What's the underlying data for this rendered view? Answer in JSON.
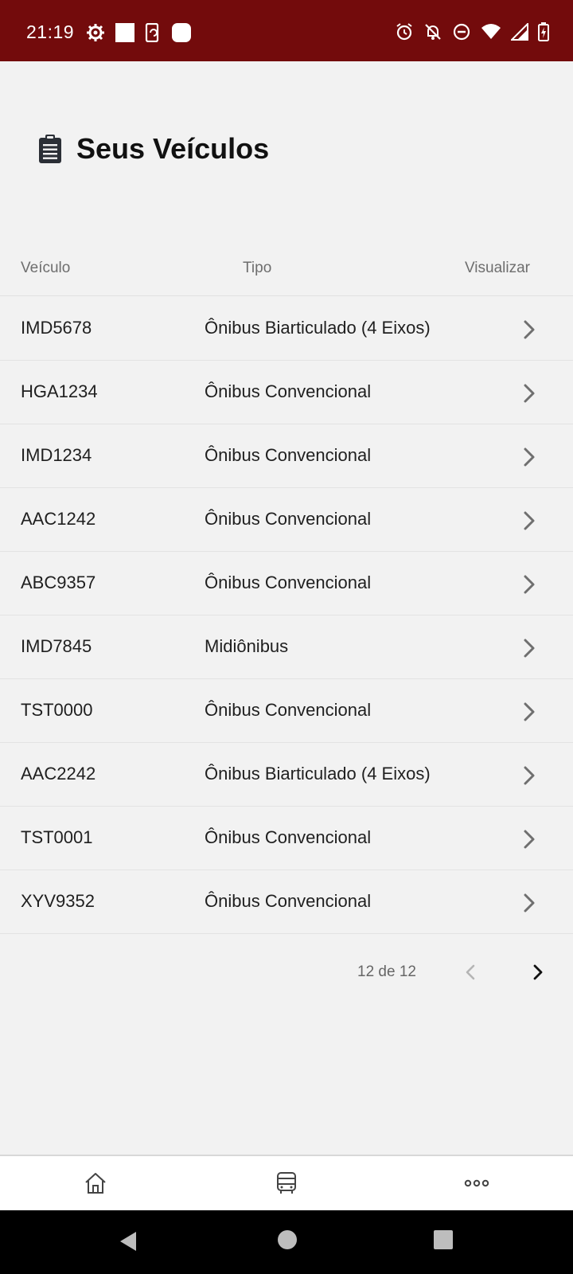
{
  "status_bar": {
    "time": "21:19",
    "left_icons": [
      "settings-gear-icon",
      "white-square-icon",
      "phone-sync-icon",
      "rounded-square-icon"
    ],
    "right_icons": [
      "alarm-icon",
      "notifications-off-icon",
      "do-not-disturb-icon",
      "wifi-icon",
      "signal-icon",
      "battery-charging-icon"
    ],
    "background": "#730b0c"
  },
  "header": {
    "icon": "clipboard-list-icon",
    "title": "Seus Veículos"
  },
  "table": {
    "columns": [
      "Veículo",
      "Tipo",
      "Visualizar"
    ],
    "rows": [
      {
        "plate": "IMD5678",
        "type": "Ônibus Biarticulado (4 Eixos)"
      },
      {
        "plate": "HGA1234",
        "type": "Ônibus Convencional"
      },
      {
        "plate": "IMD1234",
        "type": "Ônibus Convencional"
      },
      {
        "plate": "AAC1242",
        "type": "Ônibus Convencional"
      },
      {
        "plate": "ABC9357",
        "type": "Ônibus Convencional"
      },
      {
        "plate": "IMD7845",
        "type": "Midiônibus"
      },
      {
        "plate": "TST0000",
        "type": "Ônibus Convencional"
      },
      {
        "plate": "AAC2242",
        "type": "Ônibus Biarticulado (4 Eixos)"
      },
      {
        "plate": "TST0001",
        "type": "Ônibus Convencional"
      },
      {
        "plate": "XYV9352",
        "type": "Ônibus Convencional"
      }
    ]
  },
  "pagination": {
    "label": "12 de 12",
    "prev_enabled": false,
    "next_enabled": true
  },
  "bottom_nav": {
    "items": [
      "home-icon",
      "bus-icon",
      "more-icon"
    ]
  },
  "android_nav": {
    "buttons": [
      "back-icon",
      "home-circle-icon",
      "recents-icon"
    ]
  }
}
